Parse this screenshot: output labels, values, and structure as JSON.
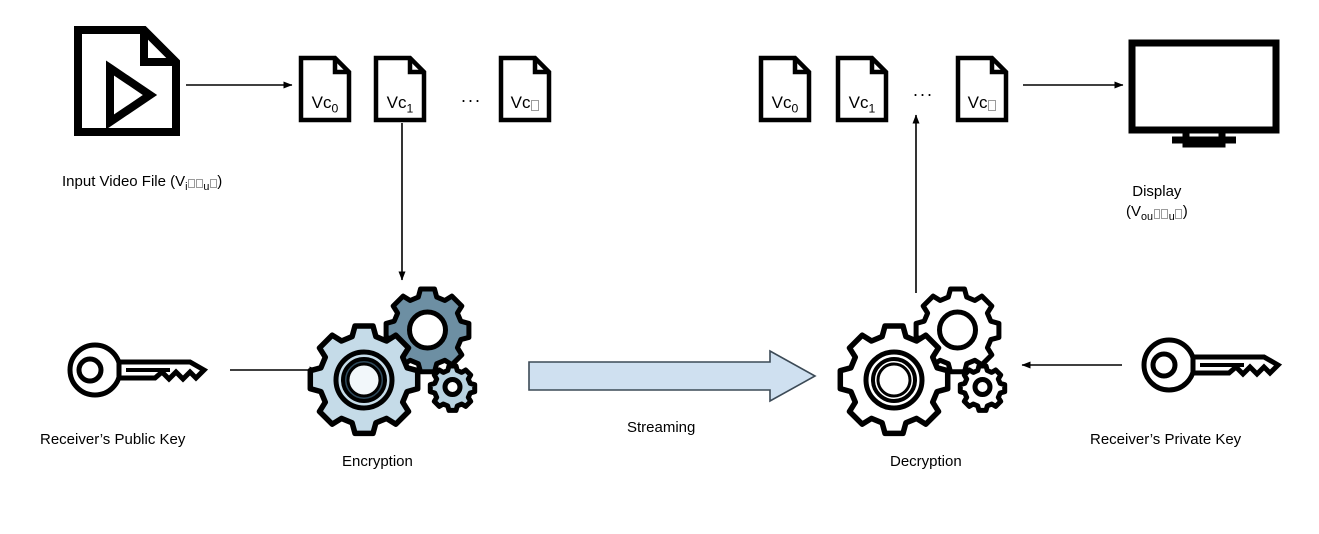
{
  "diagram": {
    "title": "Encrypted Video Streaming Pipeline",
    "background_color": "#ffffff",
    "stroke_color": "#000000",
    "gear_fill_color": "#c5dbe8",
    "streaming_arrow_fill": "#cfe0f0",
    "streaming_arrow_stroke": "#3c4a56"
  },
  "source": {
    "icon": "video-file-icon",
    "label_prefix": "Input Video File (V",
    "label_sub1": "i",
    "label_sub2": "u",
    "label_suffix": ")",
    "label_full": "Input Video File (Vi□□u□)"
  },
  "sender_chunks": {
    "items": [
      {
        "prefix": "Vc",
        "sub": "0",
        "tofu": false
      },
      {
        "prefix": "Vc",
        "sub": "1",
        "tofu": false
      },
      {
        "prefix": "Vc",
        "sub": "",
        "tofu": true
      }
    ],
    "ellipsis": "..."
  },
  "receiver_chunks": {
    "items": [
      {
        "prefix": "Vc",
        "sub": "0",
        "tofu": false
      },
      {
        "prefix": "Vc",
        "sub": "1",
        "tofu": false
      },
      {
        "prefix": "Vc",
        "sub": "",
        "tofu": true
      }
    ],
    "ellipsis": "..."
  },
  "display": {
    "icon": "monitor-icon",
    "label_line1": "Display",
    "label_prefix": "(V",
    "label_sub1": "ou",
    "label_sub2": "u",
    "label_suffix": ")",
    "label_full": "Display (Vou□□u□)"
  },
  "public_key": {
    "icon": "key-icon",
    "label": "Receiver’s Public Key"
  },
  "private_key": {
    "icon": "key-icon",
    "label": "Receiver’s Private Key"
  },
  "encryption": {
    "icon": "gears-icon",
    "label": "Encryption"
  },
  "decryption": {
    "icon": "gears-icon",
    "label": "Decryption"
  },
  "streaming": {
    "icon": "block-arrow-right-icon",
    "label": "Streaming"
  },
  "connectors": [
    {
      "name": "video-to-chunks-arrow",
      "direction": "right"
    },
    {
      "name": "chunk-to-encryption-arrow",
      "direction": "down"
    },
    {
      "name": "publickey-to-encryption-arrow",
      "direction": "right"
    },
    {
      "name": "decryption-to-chunks-arrow",
      "direction": "up"
    },
    {
      "name": "chunks-to-display-arrow",
      "direction": "right"
    },
    {
      "name": "privatekey-to-decryption-arrow",
      "direction": "left"
    }
  ]
}
